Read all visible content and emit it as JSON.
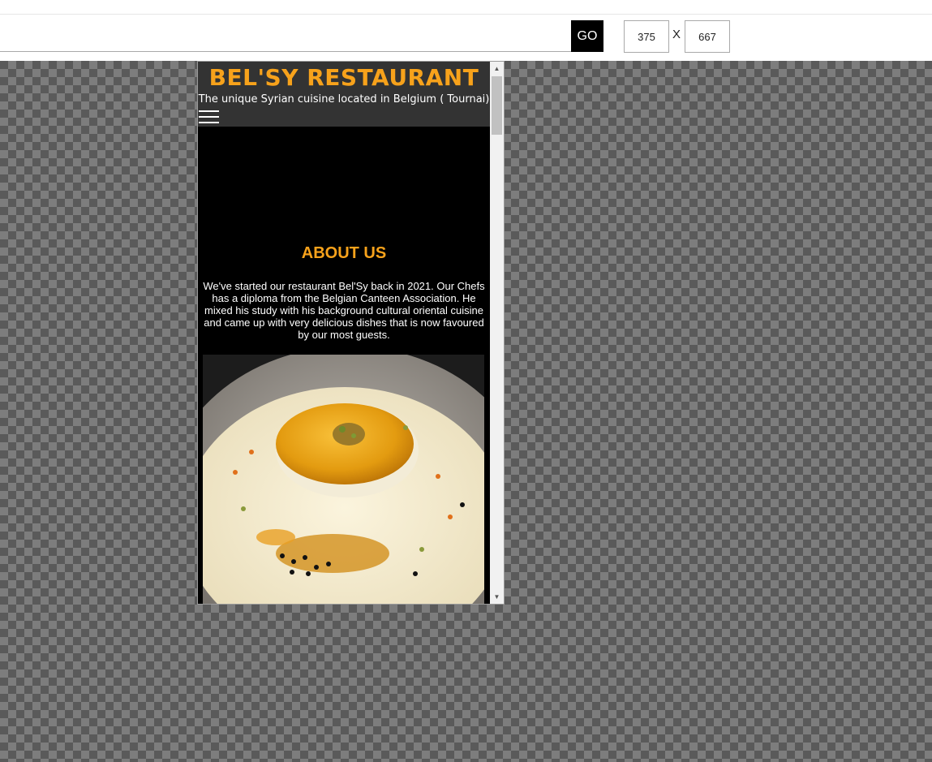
{
  "toolbar": {
    "url_value": "",
    "go_label": "GO",
    "width_value": "375",
    "separator": "X",
    "height_value": "667"
  },
  "site": {
    "title": "BEL'SY RESTAURANT",
    "subtitle": "The unique Syrian cuisine located in Belgium ( Tournai)",
    "menu_icon": "hamburger-menu-icon"
  },
  "about": {
    "heading": "ABOUT US",
    "text": "We've started our restaurant Bel'Sy back in 2021. Our Chefs has a diploma from the Belgian Canteen Association. He mixed his study with his background cultural oriental cuisine and came up with very delicious dishes that is now favoured by our most guests."
  },
  "colors": {
    "accent": "#f7a21b",
    "header_bg": "#333333",
    "page_bg": "#000000"
  }
}
